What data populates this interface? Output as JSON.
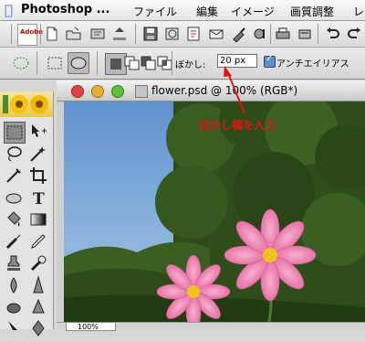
{
  "menubar": {
    "app_name": "Photoshop ...",
    "items": [
      "ファイル",
      "編集",
      "イメージ",
      "画質調整",
      "レ"
    ]
  },
  "options": {
    "feather_label": "ぼかし:",
    "feather_value": "20 px",
    "antialias_label": "アンチエイリアス",
    "antialias_checked": true
  },
  "document": {
    "title": "flower.psd @ 100% (RGB*)",
    "zoom": "100%"
  },
  "annotation": {
    "text": "ぼかし幅を入力"
  },
  "colors": {
    "accent_red": "#e01515",
    "selection_blue": "#5b8ed8"
  }
}
